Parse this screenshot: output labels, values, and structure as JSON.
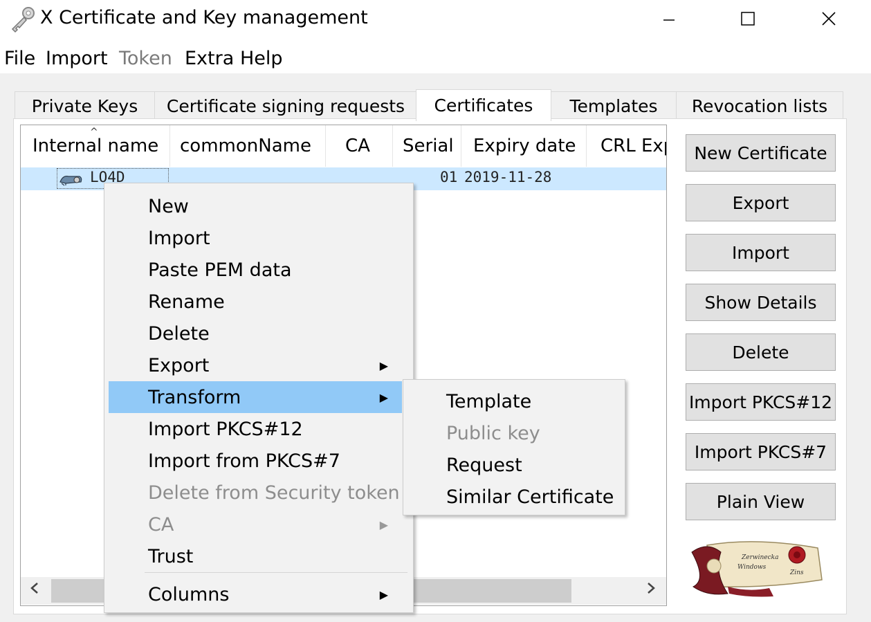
{
  "window": {
    "title": "X Certificate and Key management",
    "minimize": "—",
    "maximize": "☐",
    "close": "✕"
  },
  "menubar": {
    "file": "File",
    "import": "Import",
    "token": "Token",
    "extra": "Extra",
    "help": "Help"
  },
  "tabs": [
    {
      "label": "Private Keys"
    },
    {
      "label": "Certificate signing requests"
    },
    {
      "label": "Certificates"
    },
    {
      "label": "Templates"
    },
    {
      "label": "Revocation lists"
    }
  ],
  "table": {
    "columns": [
      "Internal name",
      "commonName",
      "CA",
      "Serial",
      "Expiry date",
      "CRL Exp"
    ],
    "rows": [
      {
        "internal_name": "LO4D",
        "serial": "01",
        "expiry": "2019-11-28"
      }
    ]
  },
  "buttons": {
    "new_certificate": "New Certificate",
    "export": "Export",
    "import": "Import",
    "show_details": "Show Details",
    "delete": "Delete",
    "import_pkcs12": "Import PKCS#12",
    "import_pkcs7": "Import PKCS#7",
    "plain_view": "Plain View"
  },
  "context_menu": {
    "items": [
      {
        "label": "New"
      },
      {
        "label": "Import"
      },
      {
        "label": "Paste PEM data"
      },
      {
        "label": "Rename"
      },
      {
        "label": "Delete"
      },
      {
        "label": "Export"
      },
      {
        "label": "Transform"
      },
      {
        "label": "Import PKCS#12"
      },
      {
        "label": "Import from PKCS#7"
      },
      {
        "label": "Delete from Security token"
      },
      {
        "label": "CA"
      },
      {
        "label": "Trust"
      },
      {
        "label": "Columns"
      }
    ]
  },
  "submenu": {
    "items": [
      {
        "label": "Template"
      },
      {
        "label": "Public key"
      },
      {
        "label": "Request"
      },
      {
        "label": "Similar Certificate"
      }
    ]
  },
  "logo": {
    "text_line1": "Zerwinecka",
    "text_line2": "Windows",
    "text_line3": "Zins"
  },
  "colors": {
    "selection": "#cce8ff",
    "menu_highlight": "#91c9f7"
  }
}
